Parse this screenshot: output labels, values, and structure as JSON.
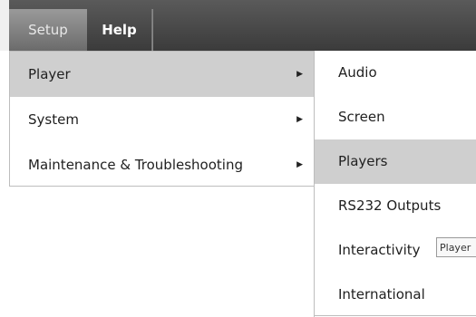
{
  "menubar": {
    "items": [
      {
        "label": "Setup",
        "active": true
      },
      {
        "label": "Help",
        "active": false
      }
    ]
  },
  "dropdown": {
    "items": [
      {
        "label": "Player",
        "has_submenu": true,
        "selected": true
      },
      {
        "label": "System",
        "has_submenu": true,
        "selected": false
      },
      {
        "label": "Maintenance & Troubleshooting",
        "has_submenu": true,
        "selected": false
      }
    ],
    "arrow_glyph": "▶"
  },
  "submenu": {
    "items": [
      {
        "label": "Audio"
      },
      {
        "label": "Screen"
      },
      {
        "label": "Players",
        "selected": true
      },
      {
        "label": "RS232 Outputs"
      },
      {
        "label": "Interactivity"
      },
      {
        "label": "International"
      }
    ]
  },
  "tooltip": {
    "text": "Player"
  },
  "colors": {
    "menubar_bg": "#4a4a4a",
    "active_tab_bg": "#8a8a8a",
    "highlight_bg": "#cfcfcf"
  }
}
